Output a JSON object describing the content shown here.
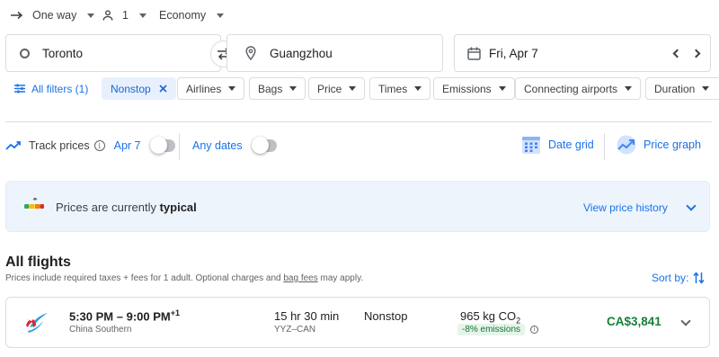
{
  "trip_options": {
    "trip_type": "One way",
    "passengers": "1",
    "cabin_class": "Economy"
  },
  "search": {
    "origin": "Toronto",
    "destination": "Guangzhou",
    "date": "Fri, Apr 7"
  },
  "filters": {
    "all_filters": "All filters (1)",
    "chips": [
      {
        "label": "Nonstop",
        "active": true
      },
      {
        "label": "Airlines"
      },
      {
        "label": "Bags"
      },
      {
        "label": "Price"
      },
      {
        "label": "Times"
      },
      {
        "label": "Emissions"
      },
      {
        "label": "Connecting airports"
      },
      {
        "label": "Duration"
      }
    ]
  },
  "tracking": {
    "track_prices": "Track prices",
    "date_label": "Apr 7",
    "any_dates": "Any dates",
    "date_grid": "Date grid",
    "price_graph": "Price graph"
  },
  "price_banner": {
    "text_prefix": "Prices are currently ",
    "text_emphasis": "typical",
    "history_link": "View price history"
  },
  "results": {
    "heading": "All flights",
    "note_prefix": "Prices include required taxes + fees for 1 adult. Optional charges and ",
    "note_link": "bag fees",
    "note_suffix": " may apply.",
    "sort_label": "Sort by:"
  },
  "flights": [
    {
      "times": "5:30 PM – 9:00 PM",
      "day_offset": "+1",
      "airline": "China Southern",
      "duration": "15 hr 30 min",
      "route": "YYZ–CAN",
      "stops": "Nonstop",
      "emissions_value": "965 kg CO",
      "emissions_sub": "2",
      "emissions_badge": "-8% emissions",
      "price": "CA$3,841"
    }
  ],
  "colors": {
    "accent": "#1a73e8",
    "price_green": "#188038",
    "badge_bg": "#e6f4ea",
    "banner_bg": "#eef4fc"
  }
}
